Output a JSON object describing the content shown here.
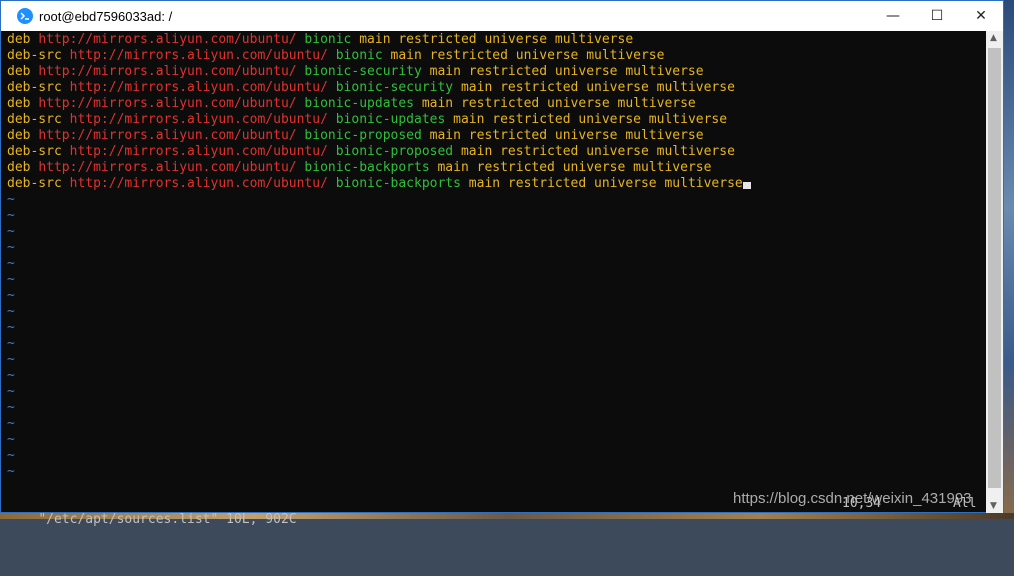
{
  "window": {
    "title": "root@ebd7596033ad: /"
  },
  "controls": {
    "minimize": "—",
    "maximize": "☐",
    "close": "✕"
  },
  "lines": [
    {
      "type": "deb",
      "url": "http://mirrors.aliyun.com/ubuntu/",
      "suite": "bionic",
      "components": "main restricted universe multiverse"
    },
    {
      "type": "deb-src",
      "url": "http://mirrors.aliyun.com/ubuntu/",
      "suite": "bionic",
      "components": "main restricted universe multiverse"
    },
    {
      "type": "deb",
      "url": "http://mirrors.aliyun.com/ubuntu/",
      "suite": "bionic-security",
      "components": "main restricted universe multiverse"
    },
    {
      "type": "deb-src",
      "url": "http://mirrors.aliyun.com/ubuntu/",
      "suite": "bionic-security",
      "components": "main restricted universe multiverse"
    },
    {
      "type": "deb",
      "url": "http://mirrors.aliyun.com/ubuntu/",
      "suite": "bionic-updates",
      "components": "main restricted universe multiverse"
    },
    {
      "type": "deb-src",
      "url": "http://mirrors.aliyun.com/ubuntu/",
      "suite": "bionic-updates",
      "components": "main restricted universe multiverse"
    },
    {
      "type": "deb",
      "url": "http://mirrors.aliyun.com/ubuntu/",
      "suite": "bionic-proposed",
      "components": "main restricted universe multiverse"
    },
    {
      "type": "deb-src",
      "url": "http://mirrors.aliyun.com/ubuntu/",
      "suite": "bionic-proposed",
      "components": "main restricted universe multiverse"
    },
    {
      "type": "deb",
      "url": "http://mirrors.aliyun.com/ubuntu/",
      "suite": "bionic-backports",
      "components": "main restricted universe multiverse"
    },
    {
      "type": "deb-src",
      "url": "http://mirrors.aliyun.com/ubuntu/",
      "suite": "bionic-backports",
      "components": "main restricted universe multiverse"
    }
  ],
  "empty_line_marker": "~",
  "status": {
    "file": "\"/etc/apt/sources.list\" 10L, 902C",
    "position": "10,34",
    "percent": "All"
  },
  "watermark": "https://blog.csdn.net/weixin_431993",
  "colors": {
    "keyword": "#e6b422",
    "url": "#e0312d",
    "suite": "#2fbf3a",
    "tilde": "#3a7bd5"
  }
}
